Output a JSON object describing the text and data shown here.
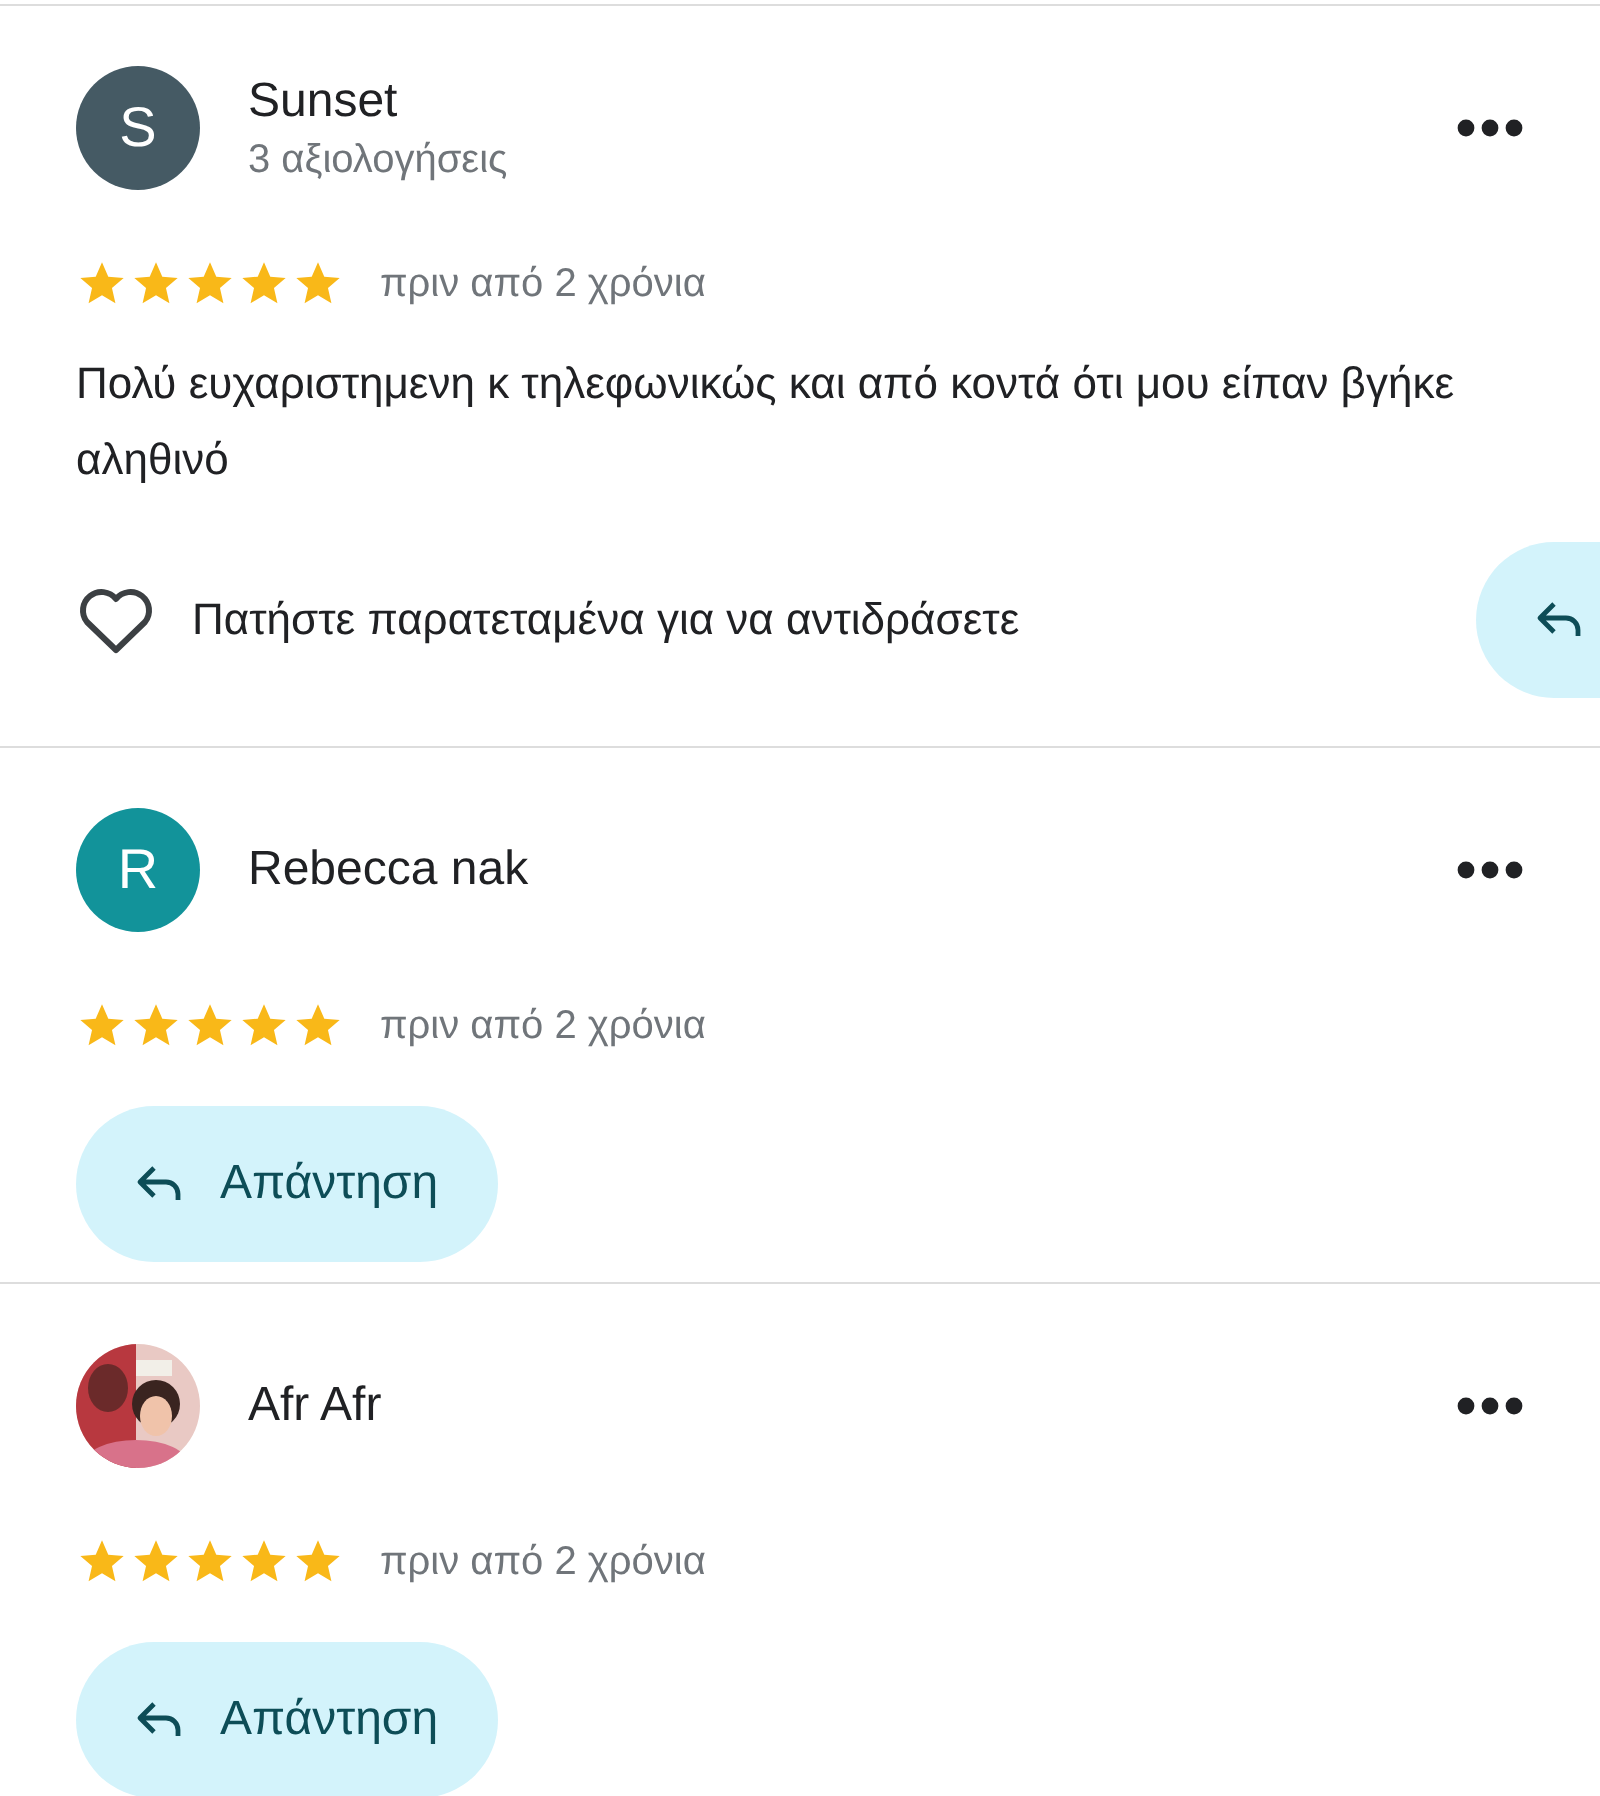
{
  "reviews": [
    {
      "name": "Sunset",
      "avatar": {
        "kind": "letter",
        "letter": "S",
        "color": "#455a64"
      },
      "subtitle": "3 αξιολογήσεις",
      "stars": 5,
      "time": "πριν από 2 χρόνια",
      "text": "Πολύ ευχαριστημενη κ τηλεφωνικώς και από κοντά ότι μου είπαν βγήκε αληθινό",
      "react_hint": "Πατήστε παρατεταμένα για να αντιδράσετε",
      "reply": {
        "kind": "icon_only"
      }
    },
    {
      "name": "Rebecca nak",
      "avatar": {
        "kind": "letter",
        "letter": "R",
        "color": "#12939a"
      },
      "stars": 5,
      "time": "πριν από 2 χρόνια",
      "reply": {
        "kind": "labeled",
        "label": "Απάντηση"
      }
    },
    {
      "name": "Afr Afr",
      "stars": 5,
      "time": "πριν από 2 χρόνια",
      "reply": {
        "kind": "labeled",
        "label": "Απάντηση"
      }
    }
  ]
}
